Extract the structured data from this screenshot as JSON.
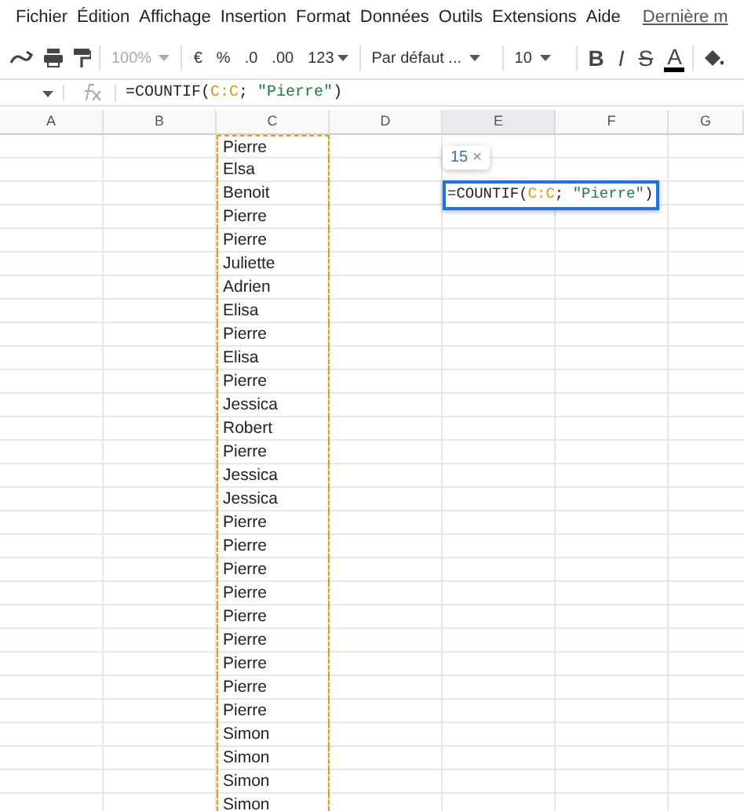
{
  "menu": {
    "items": [
      "Fichier",
      "Édition",
      "Affichage",
      "Insertion",
      "Format",
      "Données",
      "Outils",
      "Extensions",
      "Aide"
    ],
    "last_edit_link": "Dernière m"
  },
  "toolbar": {
    "zoom": "100%",
    "currency": "€",
    "percent": "%",
    "decrease_decimals": ".0",
    "increase_decimals": ".00",
    "number_format": "123",
    "font": "Par défaut ...",
    "font_size": "10",
    "bold": "B",
    "italic": "I",
    "strikethrough": "S",
    "text_color": "A"
  },
  "formula_bar": {
    "segments": [
      {
        "kind": "plain",
        "text": "=COUNTIF("
      },
      {
        "kind": "range",
        "text": "C:C"
      },
      {
        "kind": "plain",
        "text": "; "
      },
      {
        "kind": "string",
        "text": "\"Pierre\""
      },
      {
        "kind": "plain",
        "text": ")"
      }
    ]
  },
  "columns": [
    {
      "label": "A",
      "selected": false
    },
    {
      "label": "B",
      "selected": false
    },
    {
      "label": "C",
      "selected": false
    },
    {
      "label": "D",
      "selected": false
    },
    {
      "label": "E",
      "selected": true
    },
    {
      "label": "F",
      "selected": false
    },
    {
      "label": "G",
      "selected": false
    }
  ],
  "result_tooltip": {
    "value": "15",
    "close": "×"
  },
  "rows": [
    {
      "c": "Pierre"
    },
    {
      "c": "Elsa"
    },
    {
      "c": "Benoit",
      "e_formula": [
        {
          "kind": "plain",
          "text": "=COUNTIF("
        },
        {
          "kind": "range",
          "text": "C:C"
        },
        {
          "kind": "plain",
          "text": "; "
        },
        {
          "kind": "string",
          "text": "\"Pierre\""
        },
        {
          "kind": "plain",
          "text": ")"
        }
      ]
    },
    {
      "c": "Pierre"
    },
    {
      "c": "Pierre"
    },
    {
      "c": "Juliette"
    },
    {
      "c": "Adrien"
    },
    {
      "c": "Elisa"
    },
    {
      "c": "Pierre"
    },
    {
      "c": "Elisa"
    },
    {
      "c": "Pierre"
    },
    {
      "c": "Jessica"
    },
    {
      "c": "Robert"
    },
    {
      "c": "Pierre"
    },
    {
      "c": "Jessica"
    },
    {
      "c": "Jessica"
    },
    {
      "c": "Pierre"
    },
    {
      "c": "Pierre"
    },
    {
      "c": "Pierre"
    },
    {
      "c": "Pierre"
    },
    {
      "c": "Pierre"
    },
    {
      "c": "Pierre"
    },
    {
      "c": "Pierre"
    },
    {
      "c": "Pierre"
    },
    {
      "c": "Pierre"
    },
    {
      "c": "Simon"
    },
    {
      "c": "Simon"
    },
    {
      "c": "Simon"
    },
    {
      "c": "Simon"
    }
  ]
}
